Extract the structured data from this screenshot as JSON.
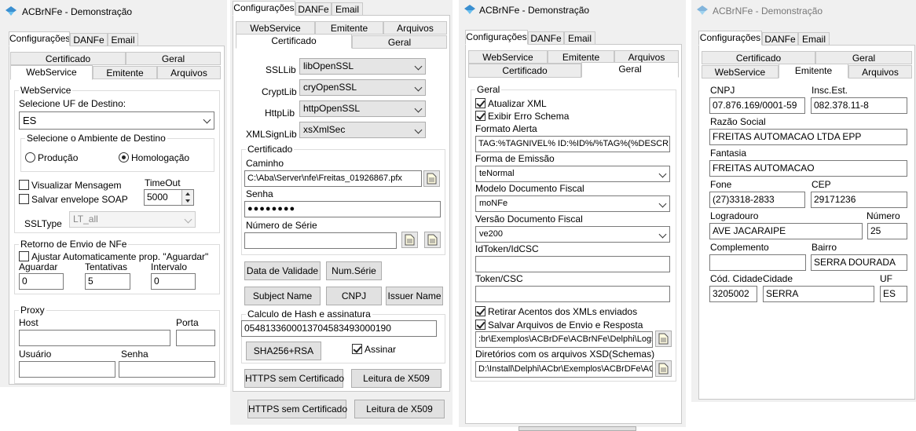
{
  "windows": {
    "title": "ACBrNFe - Demonstração",
    "main_tabs": [
      "Configurações",
      "DANFe",
      "Email"
    ],
    "sub_tabs": {
      "certificado": "Certificado",
      "geral": "Geral",
      "webservice": "WebService",
      "emitente": "Emitente",
      "arquivos": "Arquivos"
    }
  },
  "panel1": {
    "ws_group": "WebService",
    "uf_label": "Selecione UF de Destino:",
    "uf_value": "ES",
    "amb_group": "Selecione o Ambiente de Destino",
    "amb_producao": "Produção",
    "amb_homologacao": "Homologação",
    "visualizar": "Visualizar Mensagem",
    "salvar_soap": "Salvar envelope SOAP",
    "timeout_label": "TimeOut",
    "timeout_value": "5000",
    "ssltype_label": "SSLType",
    "ssltype_value": "LT_all",
    "retorno_group": "Retorno de Envio de NFe",
    "ajustar": "Ajustar Automaticamente prop. \"Aguardar\"",
    "aguardar_label": "Aguardar",
    "aguardar_value": "0",
    "tentativas_label": "Tentativas",
    "tentativas_value": "5",
    "intervalo_label": "Intervalo",
    "intervalo_value": "0",
    "proxy_group": "Proxy",
    "host": "Host",
    "porta": "Porta",
    "usuario": "Usuário",
    "senha": "Senha"
  },
  "panel2": {
    "ssllib_label": "SSLLib",
    "ssllib": "libOpenSSL",
    "cryptlib_label": "CryptLib",
    "cryptlib": "cryOpenSSL",
    "httplib_label": "HttpLib",
    "httplib": "httpOpenSSL",
    "xmlsign_label": "XMLSignLib",
    "xmlsign": "xsXmlSec",
    "cert_group": "Certificado",
    "caminho_label": "Caminho",
    "caminho_value": "C:\\Aba\\Server\\nfe\\Freitas_01926867.pfx",
    "senha_label": "Senha",
    "senha_value": "●●●●●●●●",
    "serie_label": "Número de Série",
    "data_validade": "Data de Validade",
    "num_serie": "Num.Série",
    "subject_name": "Subject Name",
    "cnpj": "CNPJ",
    "issuer_name": "Issuer Name",
    "hash_group": "Calculo de Hash e assinatura",
    "hash_value": "05481336000137045834930001​90",
    "sha256": "SHA256+RSA",
    "assinar": "Assinar",
    "https_sem": "HTTPS sem Certificado",
    "leitura": "Leitura de X509"
  },
  "panel3": {
    "geral_group": "Geral",
    "atualizar": "Atualizar XML",
    "exibir_erro": "Exibir Erro Schema",
    "formato_label": "Formato Alerta",
    "formato_value": "TAG:%TAGNIVEL% ID:%ID%/%TAG%(%DESCRICA",
    "forma_label": "Forma de Emissão",
    "forma_value": "teNormal",
    "modelo_label": "Modelo Documento Fiscal",
    "modelo_value": "moNFe",
    "versao_label": "Versão Documento Fiscal",
    "versao_value": "ve200",
    "idtoken_label": "IdToken/IdCSC",
    "token_label": "Token/CSC",
    "retirar": "Retirar Acentos dos XMLs enviados",
    "salvar_arq": "Salvar Arquivos de Envio e Resposta",
    "logs_value": ":br\\Exemplos\\ACBrDFe\\ACBrNFe\\Delphi\\Logs",
    "schemas_label": "Diretórios com os arquivos XSD(Schemas)",
    "schemas_value": "D:\\Install\\Delphi\\ACbr\\Exemplos\\ACBrDFe\\AC"
  },
  "panel4": {
    "cnpj_label": "CNPJ",
    "cnpj_value": "07.876.169/0001-59",
    "ie_label": "Insc.Est.",
    "ie_value": "082.378.11-8",
    "razao_label": "Razão Social",
    "razao_value": "FREITAS AUTOMACAO LTDA EPP",
    "fantasia_label": "Fantasia",
    "fantasia_value": "FREITAS AUTOMACAO",
    "fone_label": "Fone",
    "fone_value": "(27)3318-2833",
    "cep_label": "CEP",
    "cep_value": "29171236",
    "logradouro_label": "Logradouro",
    "logradouro_value": "AVE JACARAIPE",
    "numero_label": "Número",
    "numero_value": "25",
    "complemento_label": "Complemento",
    "bairro_label": "Bairro",
    "bairro_value": "SERRA DOURADA",
    "cod_cidade_label": "Cód. Cidade",
    "cod_cidade_value": "3205002",
    "cidade_label": "Cidade",
    "cidade_value": "SERRA",
    "uf_label": "UF",
    "uf_value": "ES"
  }
}
